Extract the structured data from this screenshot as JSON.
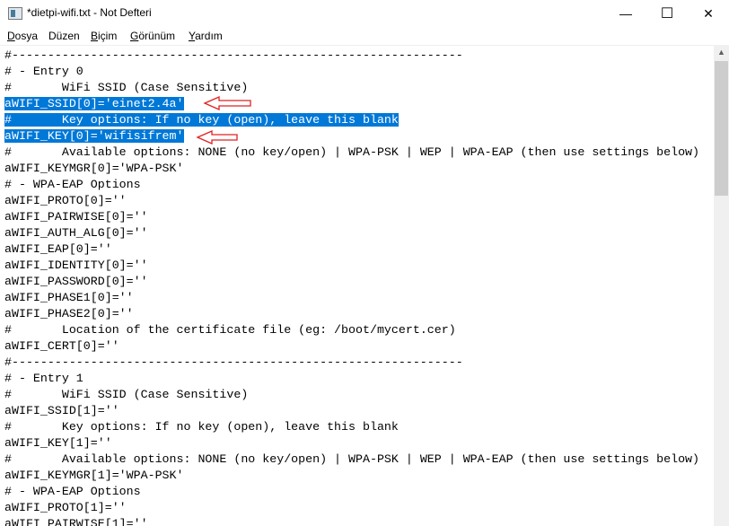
{
  "window": {
    "title": "*dietpi-wifi.txt - Not Defteri",
    "minimize": "—",
    "maximize": "☐",
    "close": "✕"
  },
  "menu": [
    {
      "key": "D",
      "rest": "osya"
    },
    {
      "key": "",
      "rest": "Düzen"
    },
    {
      "key": "B",
      "rest": "içim"
    },
    {
      "key": "G",
      "rest": "örünüm"
    },
    {
      "key": "Y",
      "rest": "ardım"
    }
  ],
  "lines": [
    "#---------------------------------------------------------------",
    "# - Entry 0",
    "#\tWiFi SSID (Case Sensitive)",
    "aWIFI_SSID[0]='einet2.4a'",
    "#\tKey options: If no key (open), leave this blank",
    "aWIFI_KEY[0]='wifisifrem'",
    "#\tAvailable options: NONE (no key/open) | WPA-PSK | WEP | WPA-EAP (then use settings below)",
    "aWIFI_KEYMGR[0]='WPA-PSK'",
    "# - WPA-EAP Options",
    "aWIFI_PROTO[0]=''",
    "aWIFI_PAIRWISE[0]=''",
    "aWIFI_AUTH_ALG[0]=''",
    "aWIFI_EAP[0]=''",
    "aWIFI_IDENTITY[0]=''",
    "aWIFI_PASSWORD[0]=''",
    "aWIFI_PHASE1[0]=''",
    "aWIFI_PHASE2[0]=''",
    "#\tLocation of the certificate file (eg: /boot/mycert.cer)",
    "aWIFI_CERT[0]=''",
    "#---------------------------------------------------------------",
    "# - Entry 1",
    "#\tWiFi SSID (Case Sensitive)",
    "aWIFI_SSID[1]=''",
    "#\tKey options: If no key (open), leave this blank",
    "aWIFI_KEY[1]=''",
    "#\tAvailable options: NONE (no key/open) | WPA-PSK | WEP | WPA-EAP (then use settings below)",
    "aWIFI_KEYMGR[1]='WPA-PSK'",
    "# - WPA-EAP Options",
    "aWIFI_PROTO[1]=''",
    "aWIFI_PAIRWISE[1]=''"
  ],
  "selected_lines": [
    3,
    4,
    5
  ],
  "colors": {
    "selection": "#0078d7",
    "annotation_arrow": "#e02020"
  }
}
